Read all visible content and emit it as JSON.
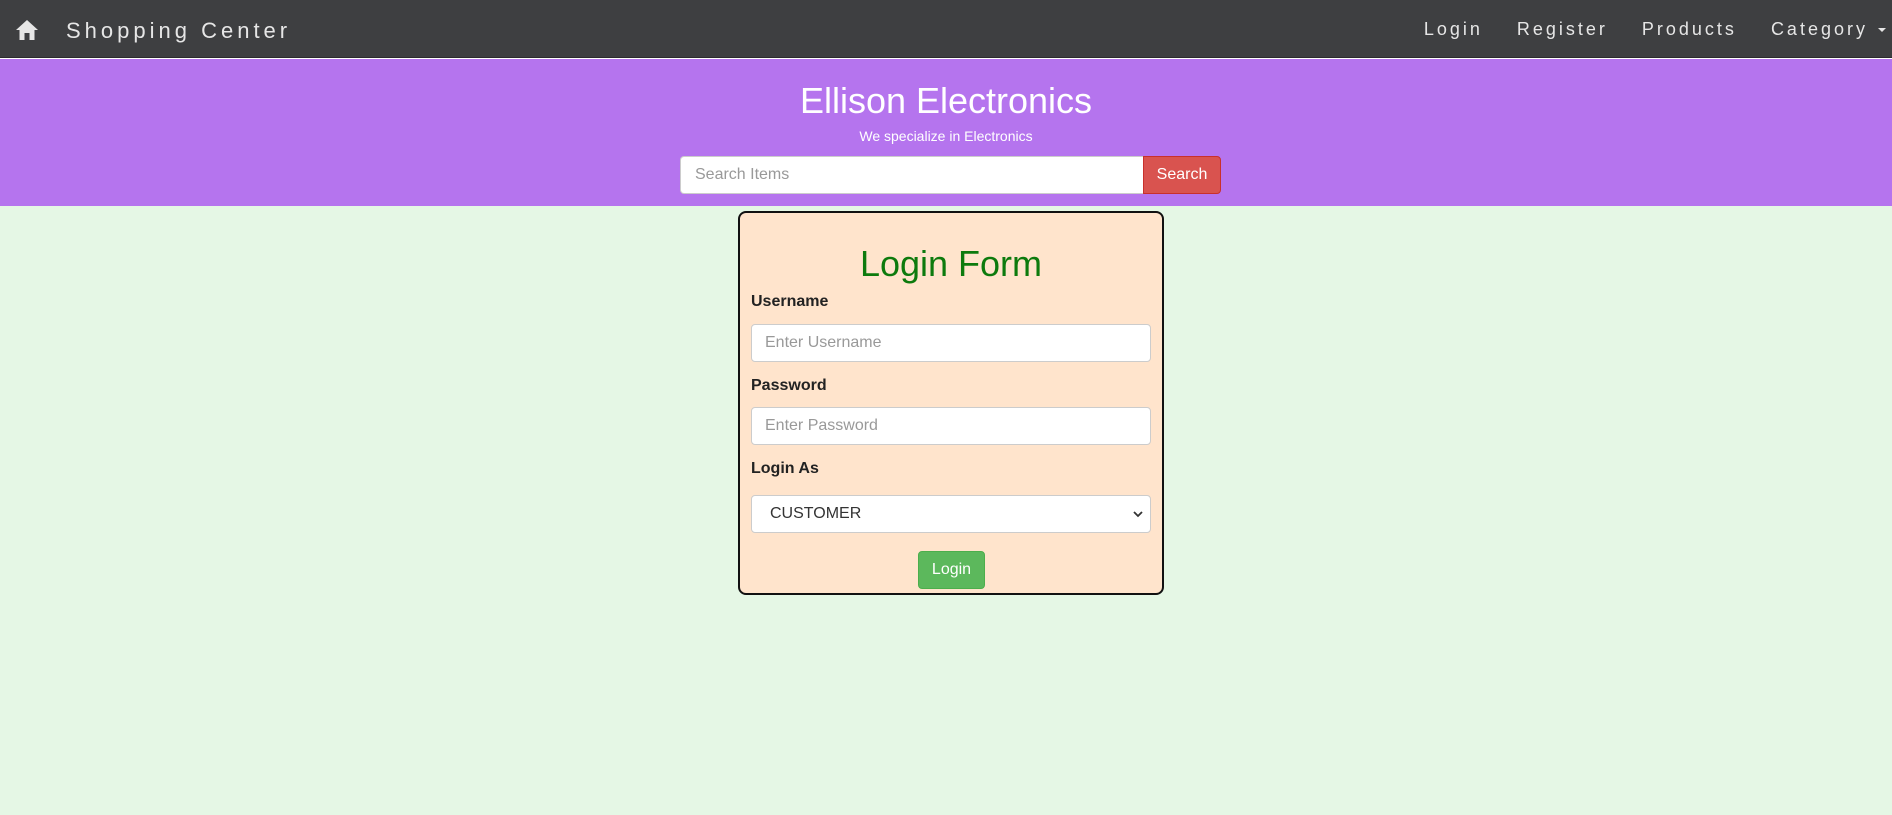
{
  "navbar": {
    "home_icon": "home-icon",
    "brand": "Shopping Center",
    "links": {
      "login": "Login",
      "register": "Register",
      "products": "Products",
      "category": "Category"
    }
  },
  "header": {
    "title": "Ellison Electronics",
    "subtitle": "We specialize in Electronics",
    "search": {
      "placeholder": "Search Items",
      "value": "",
      "button_label": "Search"
    }
  },
  "login_form": {
    "title": "Login Form",
    "username": {
      "label": "Username",
      "placeholder": "Enter Username",
      "value": ""
    },
    "password": {
      "label": "Password",
      "placeholder": "Enter Password",
      "value": ""
    },
    "login_as": {
      "label": "Login As",
      "selected": "CUSTOMER"
    },
    "submit_label": "Login"
  },
  "colors": {
    "navbar_bg": "#3e3f41",
    "header_bg": "#b574ee",
    "main_bg": "#e5f7e5",
    "card_bg": "#ffe4cc",
    "title_green": "#0d7a0d",
    "search_button": "#d9534f",
    "login_button": "#5cb85c"
  }
}
